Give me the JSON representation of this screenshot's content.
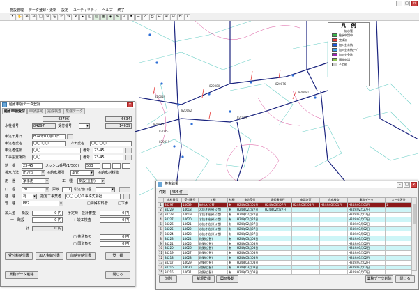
{
  "menubar": [
    "施設管理",
    "データ登録・更新",
    "設定",
    "ユーティリティ",
    "ヘルプ",
    "終了"
  ],
  "toolbar": [
    "↖",
    "✋",
    "⊕",
    "⊖",
    "□",
    "✂",
    "⎘",
    "↶",
    "↷",
    "✕",
    "⌖",
    "◫",
    "▤",
    "▦",
    "◈",
    "✎",
    "✓",
    "⚑",
    "☰",
    "⌂",
    "⎙",
    "⇔",
    "⊞",
    "⊟",
    "⧉",
    "?"
  ],
  "legend": {
    "title": "凡　例",
    "subtitle": "給水管",
    "items": [
      {
        "label": "給水申請中",
        "color": "#39b54a"
      },
      {
        "label": "完成済",
        "color": "#e53935"
      },
      {
        "label": "加入金未納",
        "color": "#1e5bd8"
      },
      {
        "label": "加入金未納ｾｰﾌﾞ",
        "color": "#3aa0e8"
      },
      {
        "label": "加入金免除",
        "color": "#9c27b0"
      },
      {
        "label": "通常申請",
        "color": "#8bc34a"
      },
      {
        "label": "その他",
        "color": "#d0d0d0"
      }
    ]
  },
  "map_labels": [
    "820019",
    "820080",
    "820076",
    "820081",
    "820082",
    "820015",
    "820057",
    "820019",
    "820109"
  ],
  "dialog": {
    "title": "給水申請データ登録",
    "tabs": [
      "給水申請受付",
      "申請許可",
      "完成検査",
      "業務データ"
    ],
    "top_values": [
      "42706",
      "6634"
    ],
    "suido_no_label": "水栓番号",
    "suido_no": "84297",
    "uketsuke_label": "受付番号",
    "uketsuke_value": "14639",
    "shinsei_date_label": "申込年月日",
    "shinsei_date": "H24年03月01日",
    "applicant_label": "申込者氏名",
    "applicant": "〇〇 〇〇",
    "kana_label": "カナ氏名",
    "kana": "〇〇 〇〇",
    "address_label": "申込者住所",
    "address": "〇〇",
    "banchi_label": "番号",
    "banchi": "23-45",
    "site_label": "工事設置場所",
    "site": "〇〇",
    "site_banchi_label": "番号",
    "site_banchi": "23-45",
    "chiban_label": "地　番",
    "chiban": "23-45",
    "mesh_label": "メッシュ番号(1/500)",
    "mesh": "503",
    "haisui_label": "排水方法",
    "haisui": "圧力式",
    "haisui_place_label": "※給水場所",
    "haisui_place": "本管",
    "water_meter_label": "※給水材料数",
    "youto_label": "用　途",
    "youto": "家事用",
    "koushu_label": "工　種",
    "koushu": "新設(立替)",
    "koukei_label": "口　径",
    "koukei": "20",
    "kosu_label": "戸数",
    "kosu": "1",
    "hikikomi_label": "引込管口径",
    "kenchiku_label": "桂　種",
    "kenchiku": "有",
    "gyosha_label": "指定工事業者",
    "gyosha": "〇〇 〇〇工事株式会社",
    "kanzai_label": "管　種",
    "kanzai": "PP2",
    "tokushu_label": "□特殊材料管",
    "gesui_label": "□下水",
    "kanyu_label": "加入金",
    "shinki_label": "新設",
    "shinki_val": "0 円",
    "sekkei_label": "予定時",
    "sekkei_sub": "設計審査",
    "sekkei_val": "0 円",
    "kobetsu_label": "一　既設",
    "kobetsu_val": "0 円",
    "kensa_label": "+ 竣工検査",
    "kensa_val": "0 円",
    "total_label": "計",
    "total_val": "0 円",
    "kouji_label": "□ 共通負担",
    "kouji_val": "0 円",
    "koukyo_label": "□ 国道負担",
    "koukyo_val": "0 円",
    "btn1": "受付料納付書",
    "btn2": "加入金納付書",
    "btn3": "前納金納付書",
    "btn_save": "登　録",
    "btn_print": "業務データ削除",
    "btn_close": "閉じる"
  },
  "grid": {
    "title": "検索結果",
    "count_label": "件数",
    "count": "454 件",
    "columns": [
      "水栓番号",
      "受付番号",
      "工種",
      "桂種",
      "申込受付",
      "通知書発行",
      "申請許可",
      "完成検査",
      "業務データ",
      "メータ区分"
    ],
    "rows": [
      [
        "84297",
        "14639",
        "給排水(立替)",
        "有",
        "H24年03月01日",
        "H24年03月07日",
        "H24年03月08日",
        "H24年05月01日",
        "H24年05月01日",
        "1"
      ],
      [
        "84229",
        "14618",
        "水抜き給水(公営)",
        "有",
        "H24年02月27日",
        "H24年02月27日",
        "",
        "",
        "H24年02月27日",
        ""
      ],
      [
        "84228",
        "14619",
        "水抜き給水(公営)",
        "有",
        "H24年02月27日",
        "",
        "",
        "",
        "H24年03月02日",
        ""
      ],
      [
        "84227",
        "14620",
        "水抜き給水(公営)",
        "有",
        "H24年02月27日",
        "",
        "",
        "",
        "H24年03月02日",
        ""
      ],
      [
        "84226",
        "14621",
        "水抜き給水(公営)",
        "有",
        "H24年02月27日",
        "",
        "",
        "",
        "H24年03月02日",
        ""
      ],
      [
        "84225",
        "14622",
        "水抜き給水(公営)",
        "有",
        "H24年02月27日",
        "",
        "",
        "",
        "H24年03月02日",
        ""
      ],
      [
        "84224",
        "14623",
        "水抜き給水(公営)",
        "有",
        "H24年02月27日",
        "",
        "",
        "",
        "H24年03月02日",
        ""
      ],
      [
        "84223",
        "14624",
        "改築(立替)",
        "有",
        "H24年03月08日",
        "",
        "",
        "",
        "H24年03月02日",
        ""
      ],
      [
        "84221",
        "14625",
        "改築(立替)",
        "有",
        "H24年03月08日",
        "",
        "",
        "",
        "H24年03月02日",
        ""
      ],
      [
        "84220",
        "14626",
        "改築(立替)",
        "有",
        "H24年03月08日",
        "",
        "",
        "",
        "H24年03月02日",
        ""
      ],
      [
        "84219",
        "14627",
        "改築(立替)",
        "有",
        "H24年03月08日",
        "",
        "",
        "",
        "H24年03月02日",
        ""
      ],
      [
        "84218",
        "14628",
        "改築(立替)",
        "有",
        "H24年03月08日",
        "",
        "",
        "",
        "H24年03月02日",
        ""
      ],
      [
        "84217",
        "14629",
        "改築(立替)",
        "有",
        "H24年03月08日",
        "",
        "",
        "",
        "H24年03月02日",
        ""
      ],
      [
        "84216",
        "14630",
        "改築(立替)",
        "有",
        "H24年03月08日",
        "",
        "",
        "",
        "H24年03月02日",
        ""
      ],
      [
        "84215",
        "14631",
        "改築(立替)",
        "有",
        "H24年03月08日",
        "",
        "",
        "",
        "H24年03月02日",
        ""
      ]
    ],
    "btn_print": "印刷",
    "btn_new": "新規登録",
    "btn_map": "図面移動",
    "btn_delete": "業務データ削除",
    "btn_close": "閉じる"
  }
}
